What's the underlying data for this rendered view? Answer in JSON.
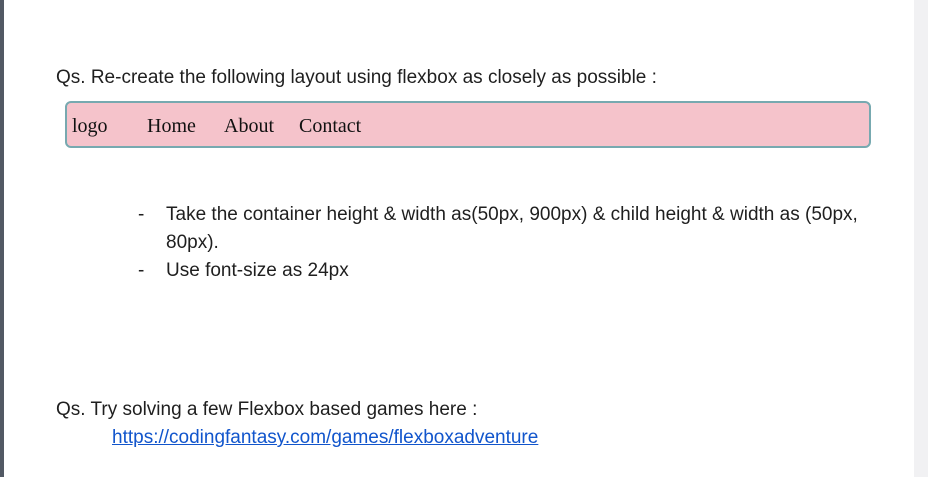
{
  "question_1": "Qs. Re-create the following layout using flexbox as closely as possible :",
  "nav_demo": {
    "items": [
      "logo",
      "Home",
      "About",
      "Contact"
    ],
    "background": "#f5c3cb",
    "border_color": "#77a9b0"
  },
  "bullets": [
    {
      "dash": "-",
      "text": "Take the container height & width as(50px, 900px) & child height & width as (50px, 80px)."
    },
    {
      "dash": "-",
      "text": "Use font-size as 24px"
    }
  ],
  "question_2": "Qs. Try solving a few Flexbox based games here :",
  "link": {
    "text": "https://codingfantasy.com/games/flexboxadventure",
    "color": "#1155cc"
  }
}
